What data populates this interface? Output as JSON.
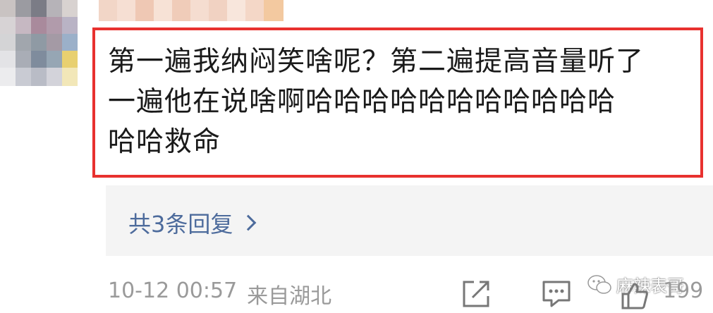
{
  "comment": {
    "lines": [
      "第一遍我纳闷笑啥呢？第二遍提高音量听了",
      "一遍他在说啥啊哈哈哈哈哈哈哈哈哈哈哈",
      "哈哈救命"
    ]
  },
  "replies": {
    "label": "共3条回复"
  },
  "meta": {
    "date": "10-12 00:57",
    "location": "来自湖北"
  },
  "watermark": {
    "text": "麻辣表哥"
  },
  "actions": {
    "like_count": "199"
  },
  "icons": [
    "share-icon",
    "comment-icon",
    "wechat-icon",
    "like-icon"
  ],
  "colors": {
    "highlight_border": "#e8312f",
    "reply_link": "#4d6b9c",
    "meta_text": "#9a9a9a",
    "reply_panel_bg": "#f4f4f4"
  }
}
